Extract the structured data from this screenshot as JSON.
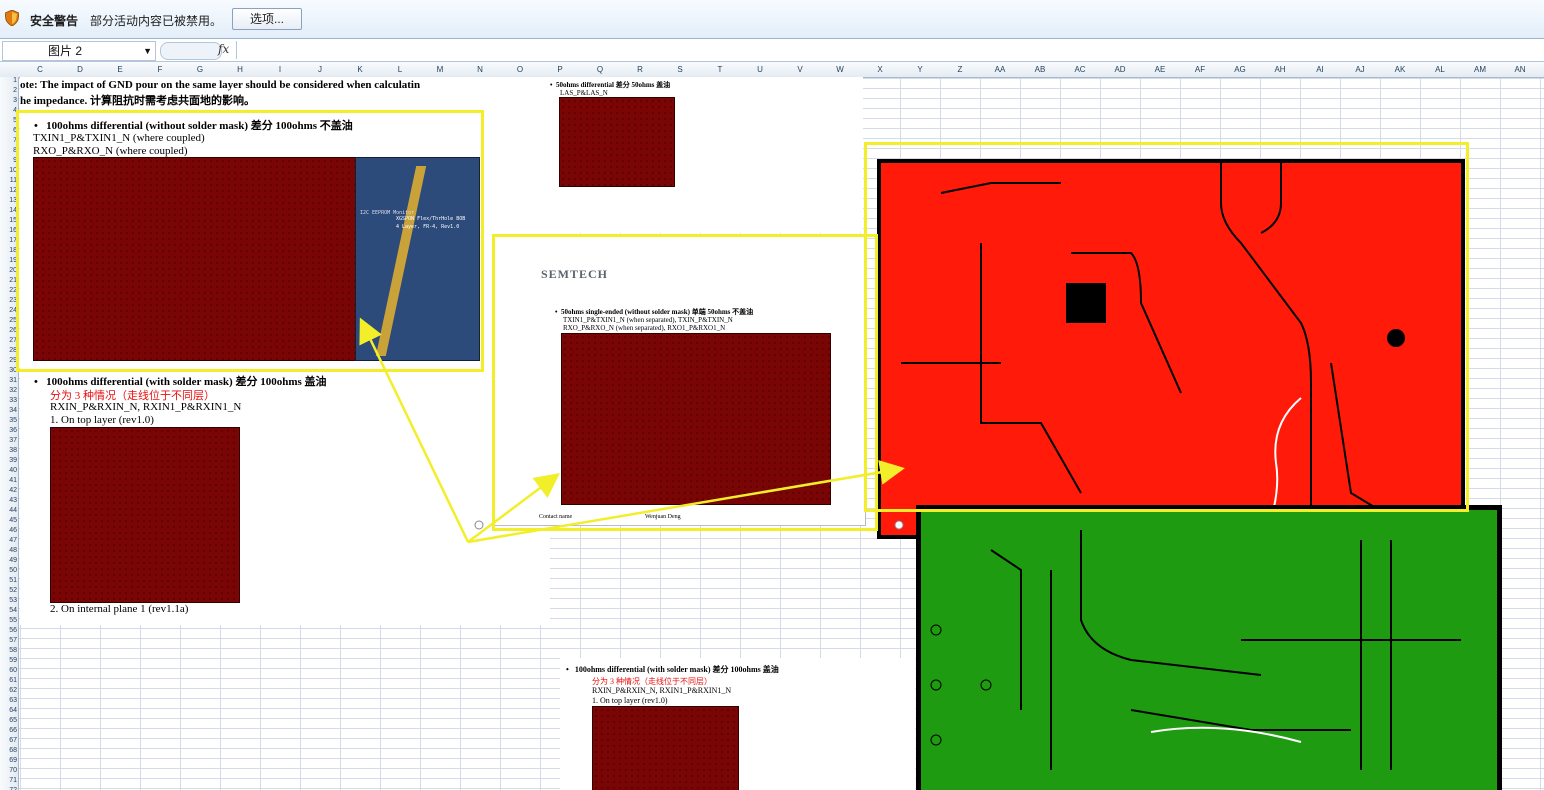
{
  "security_bar": {
    "title": "安全警告",
    "message": "部分活动内容已被禁用。",
    "options_button": "选项..."
  },
  "formula_bar": {
    "name_box": "图片 2",
    "fx": "fx",
    "value": ""
  },
  "columns": [
    "C",
    "D",
    "E",
    "F",
    "G",
    "H",
    "I",
    "J",
    "K",
    "L",
    "M",
    "N",
    "O",
    "P",
    "Q",
    "R",
    "S",
    "T",
    "U",
    "V",
    "W",
    "X",
    "Y",
    "Z",
    "AA",
    "AB",
    "AC",
    "AD",
    "AE",
    "AF",
    "AG",
    "AH",
    "AI",
    "AJ",
    "AK",
    "AL",
    "AM",
    "AN"
  ],
  "rows": [
    "1",
    "2",
    "3",
    "4",
    "5",
    "6",
    "7",
    "8",
    "9",
    "10",
    "11",
    "12",
    "13",
    "14",
    "15",
    "16",
    "17",
    "18",
    "19",
    "20",
    "21",
    "22",
    "23",
    "24",
    "25",
    "26",
    "27",
    "28",
    "29",
    "30",
    "31",
    "32",
    "33",
    "34",
    "35",
    "36",
    "37",
    "38",
    "39",
    "40",
    "41",
    "42",
    "43",
    "44",
    "45",
    "46",
    "47",
    "48",
    "49",
    "50",
    "51",
    "52",
    "53",
    "54",
    "55",
    "56",
    "57",
    "58",
    "59",
    "60",
    "61",
    "62",
    "63",
    "64",
    "65",
    "66",
    "67",
    "68",
    "69",
    "70",
    "71",
    "72"
  ],
  "doc_left": {
    "note_line1": "ote: The impact of GND pour on the same layer should be considered when calculatin",
    "note_line2": "he impedance. 计算阻抗时需考虑共面地的影响。",
    "b1_title": "100ohms differential (without solder mask) 差分 100ohms 不盖油",
    "b1_line1": "TXIN1_P&TXIN1_N (where coupled)",
    "b1_line2": "RXO_P&RXO_N (where coupled)",
    "b2_title": "100ohms differential (with solder mask) 差分 100ohms 盖油",
    "b2_red": "分为 3 种情况（走线位于不同层）",
    "b2_line1": "RXIN_P&RXIN_N, RXIN1_P&RXIN1_N",
    "b2_item1": "1.   On top layer (rev1.0)",
    "b2_item2": "2.   On internal plane 1 (rev1.1a)"
  },
  "doc_mid_top": {
    "title": "50ohms differential 差分 50ohms 盖油",
    "line1": "LAS_P&LAS_N"
  },
  "doc_mid": {
    "logo": "SEMTECH",
    "title": "50ohms single-ended (without solder mask) 单端 50ohms 不盖油",
    "line1": "TXIN1_P&TXIN1_N (when separated), TXIN_P&TXIN_N",
    "line2": "RXO_P&RXO_N (when separated), RXO1_P&RXO1_N",
    "footer_left": "Contact name",
    "footer_right": "Wenjuan Deng"
  },
  "doc_bottom": {
    "b_title": "100ohms differential (with solder mask) 差分 100ohms 盖油",
    "b_red": "分为 3 种情况（走线位于不同层）",
    "b_line1": "RXIN_P&RXIN_N, RXIN1_P&RXIN1_N",
    "b_item1": "1.   On top layer (rev1.0)"
  },
  "board_blue": {
    "label1": "XGSPON Flex/ThrHole BOB",
    "label2": "4 Layer, FR-4, Rev1.0",
    "label3": "I2C EEPROM Monitor"
  },
  "colors": {
    "highlight": "#f2ee2a",
    "pcb_red": "#ff1a0a",
    "pcb_green": "#1e9b10",
    "pcb_dark": "#7a0505",
    "warning_text": "#e81010"
  }
}
